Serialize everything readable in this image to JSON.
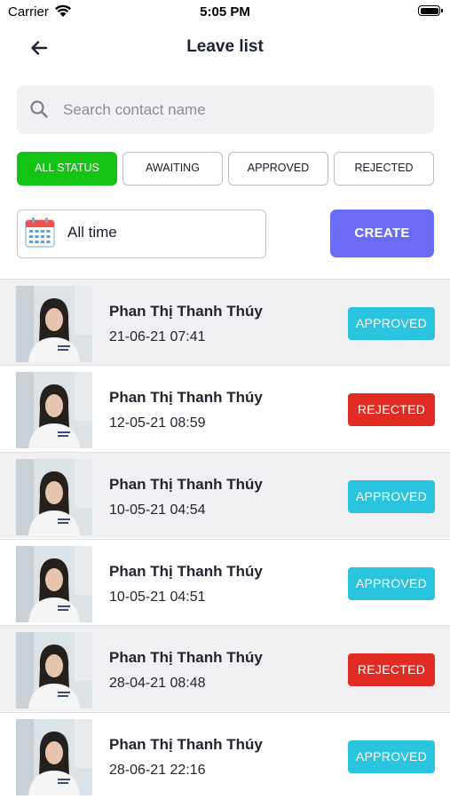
{
  "status_bar": {
    "carrier": "Carrier",
    "time": "5:05 PM",
    "icons": [
      "wifi-icon",
      "battery-icon"
    ]
  },
  "header": {
    "title": "Leave list",
    "back_icon": "arrow-left-icon"
  },
  "search": {
    "placeholder": "Search contact name",
    "value": "",
    "icon": "search-icon"
  },
  "filters": [
    {
      "label": "ALL STATUS",
      "active": true
    },
    {
      "label": "AWAITING",
      "active": false
    },
    {
      "label": "APPROVED",
      "active": false
    },
    {
      "label": "REJECTED",
      "active": false
    }
  ],
  "date_filter": {
    "label": "All time",
    "icon": "calendar-icon"
  },
  "create_button": {
    "label": "CREATE"
  },
  "colors": {
    "active_filter": "#14c414",
    "create": "#6b6cf5",
    "approved": "#2bc4df",
    "rejected": "#e02c25"
  },
  "leaves": [
    {
      "name": "Phan Thị Thanh Thúy",
      "date": "21-06-21 07:41",
      "status": "APPROVED"
    },
    {
      "name": "Phan Thị Thanh Thúy",
      "date": "12-05-21 08:59",
      "status": "REJECTED"
    },
    {
      "name": "Phan Thị Thanh Thúy",
      "date": "10-05-21 04:54",
      "status": "APPROVED"
    },
    {
      "name": "Phan Thị Thanh Thúy",
      "date": "10-05-21 04:51",
      "status": "APPROVED"
    },
    {
      "name": "Phan Thị Thanh Thúy",
      "date": "28-04-21 08:48",
      "status": "REJECTED"
    },
    {
      "name": "Phan Thị Thanh Thúy",
      "date": "28-06-21 22:16",
      "status": "APPROVED"
    }
  ]
}
